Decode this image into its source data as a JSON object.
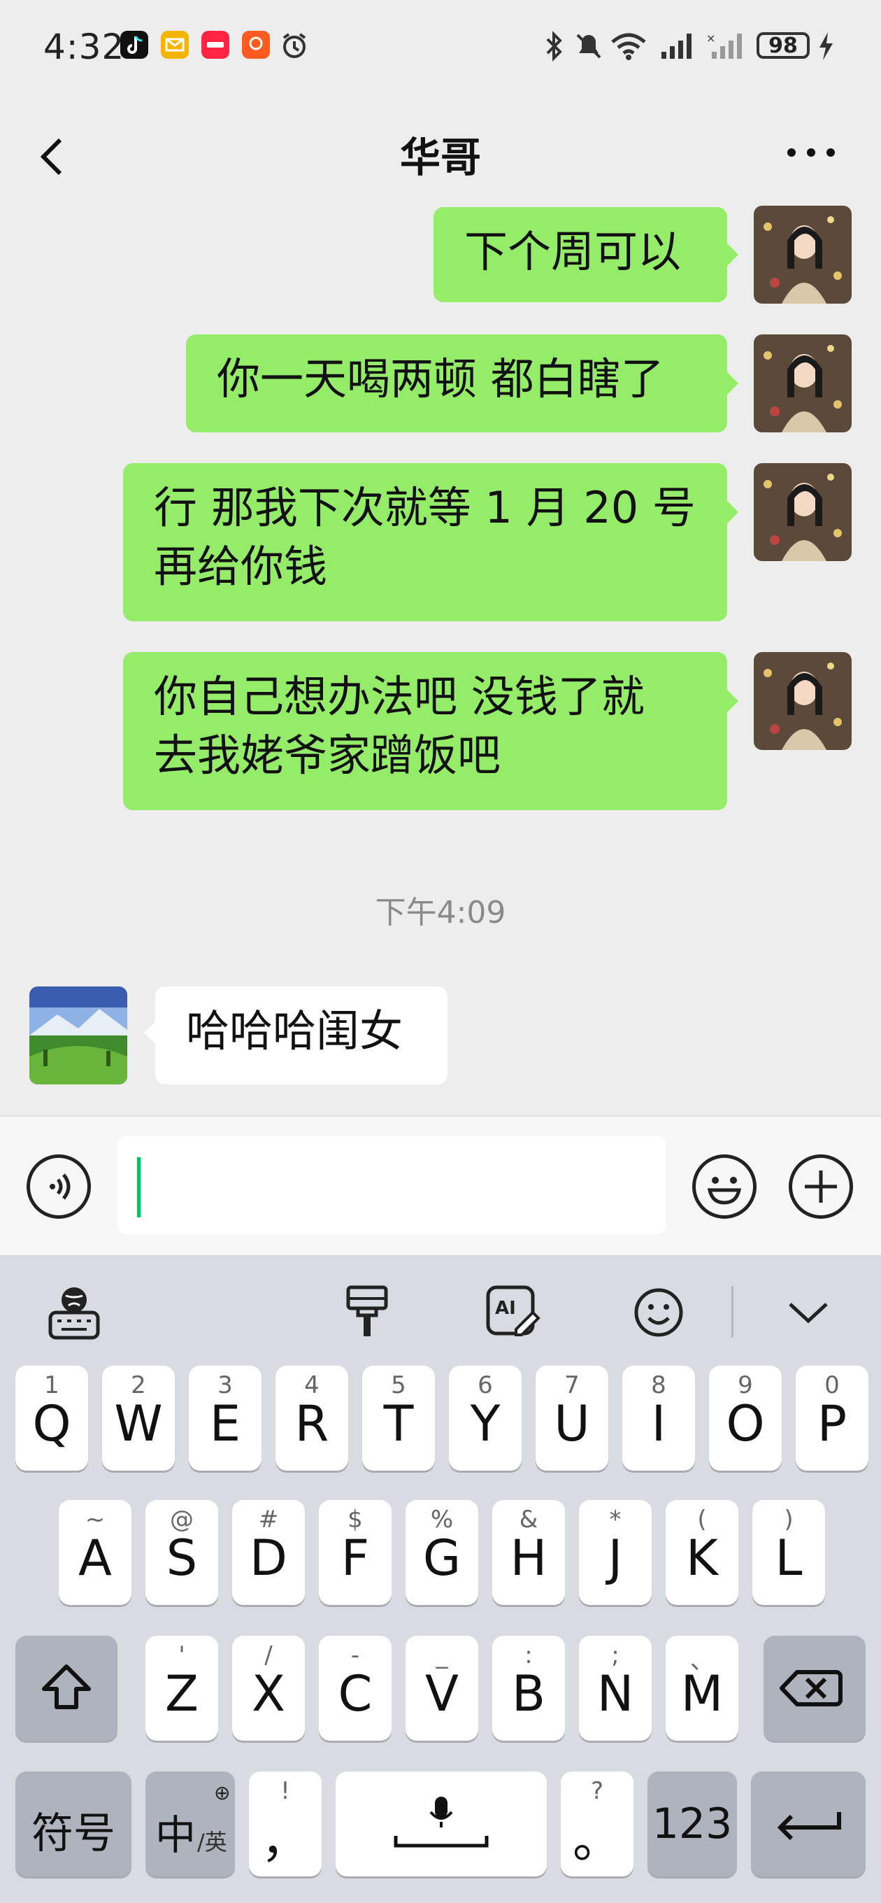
{
  "status_bar": {
    "time": "4:32",
    "battery": "98"
  },
  "header": {
    "title": "华哥"
  },
  "messages": {
    "m1": "下个周可以",
    "m2": "你一天喝两顿 都白瞎了",
    "m3_line1": "行 那我下次就等 1 月 20 号",
    "m3_line2": "再给你钱",
    "m4_line1": "你自己想办法吧 没钱了就",
    "m4_line2": "去我姥爷家蹭饭吧",
    "timestamp": "下午4:09",
    "m5": "哈哈哈闺女"
  },
  "keyboard": {
    "row1": [
      {
        "hint": "1",
        "key": "Q"
      },
      {
        "hint": "2",
        "key": "W"
      },
      {
        "hint": "3",
        "key": "E"
      },
      {
        "hint": "4",
        "key": "R"
      },
      {
        "hint": "5",
        "key": "T"
      },
      {
        "hint": "6",
        "key": "Y"
      },
      {
        "hint": "7",
        "key": "U"
      },
      {
        "hint": "8",
        "key": "I"
      },
      {
        "hint": "9",
        "key": "O"
      },
      {
        "hint": "0",
        "key": "P"
      }
    ],
    "row2": [
      {
        "hint": "~",
        "key": "A"
      },
      {
        "hint": "@",
        "key": "S"
      },
      {
        "hint": "#",
        "key": "D"
      },
      {
        "hint": "$",
        "key": "F"
      },
      {
        "hint": "%",
        "key": "G"
      },
      {
        "hint": "&",
        "key": "H"
      },
      {
        "hint": "*",
        "key": "J"
      },
      {
        "hint": "(",
        "key": "K"
      },
      {
        "hint": ")",
        "key": "L"
      }
    ],
    "row3": [
      {
        "hint": "'",
        "key": "Z"
      },
      {
        "hint": "/",
        "key": "X"
      },
      {
        "hint": "-",
        "key": "C"
      },
      {
        "hint": "_",
        "key": "V"
      },
      {
        "hint": ":",
        "key": "B"
      },
      {
        "hint": ";",
        "key": "N"
      },
      {
        "hint": "、",
        "key": "M"
      }
    ],
    "symbols_label": "符号",
    "lang_main": "中",
    "lang_sub": "/英",
    "comma": "，",
    "comma_hint": "!",
    "period": "。",
    "period_hint": "?",
    "num_label": "123"
  }
}
